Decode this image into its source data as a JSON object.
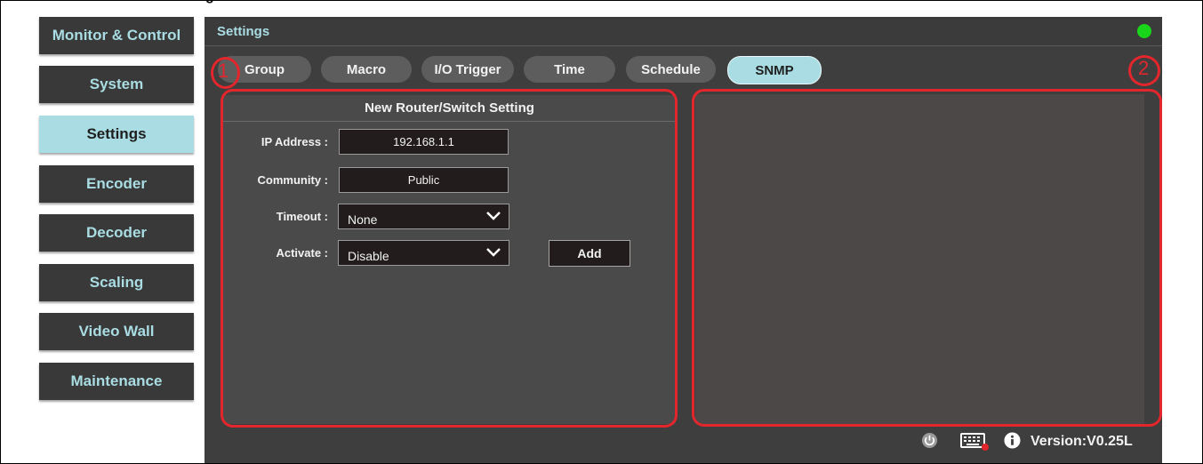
{
  "top_fragment": {
    "text": "g"
  },
  "sidebar": {
    "items": [
      {
        "label": "Monitor & Control"
      },
      {
        "label": "System"
      },
      {
        "label": "Settings"
      },
      {
        "label": "Encoder"
      },
      {
        "label": "Decoder"
      },
      {
        "label": "Scaling"
      },
      {
        "label": "Video Wall"
      },
      {
        "label": "Maintenance"
      }
    ],
    "active": "Settings"
  },
  "panel": {
    "title": "Settings",
    "status_color": "#19d61a"
  },
  "tabs": [
    {
      "label": "Group"
    },
    {
      "label": "Macro"
    },
    {
      "label": "I/O Trigger"
    },
    {
      "label": "Time"
    },
    {
      "label": "Schedule"
    },
    {
      "label": "SNMP"
    }
  ],
  "active_tab": "SNMP",
  "form": {
    "title": "New Router/Switch Setting",
    "ip_label": "IP Address :",
    "ip_value": "192.168.1.1",
    "community_label": "Community :",
    "community_value": "Public",
    "timeout_label": "Timeout :",
    "timeout_value": "None",
    "activate_label": "Activate :",
    "activate_value": "Disable",
    "add_label": "Add"
  },
  "footer": {
    "version": "Version:V0.25L",
    "icons": [
      "power-icon",
      "keyboard-icon",
      "info-icon"
    ]
  },
  "annotations": {
    "one": "1",
    "two": "2",
    "color": "#e2262c"
  }
}
